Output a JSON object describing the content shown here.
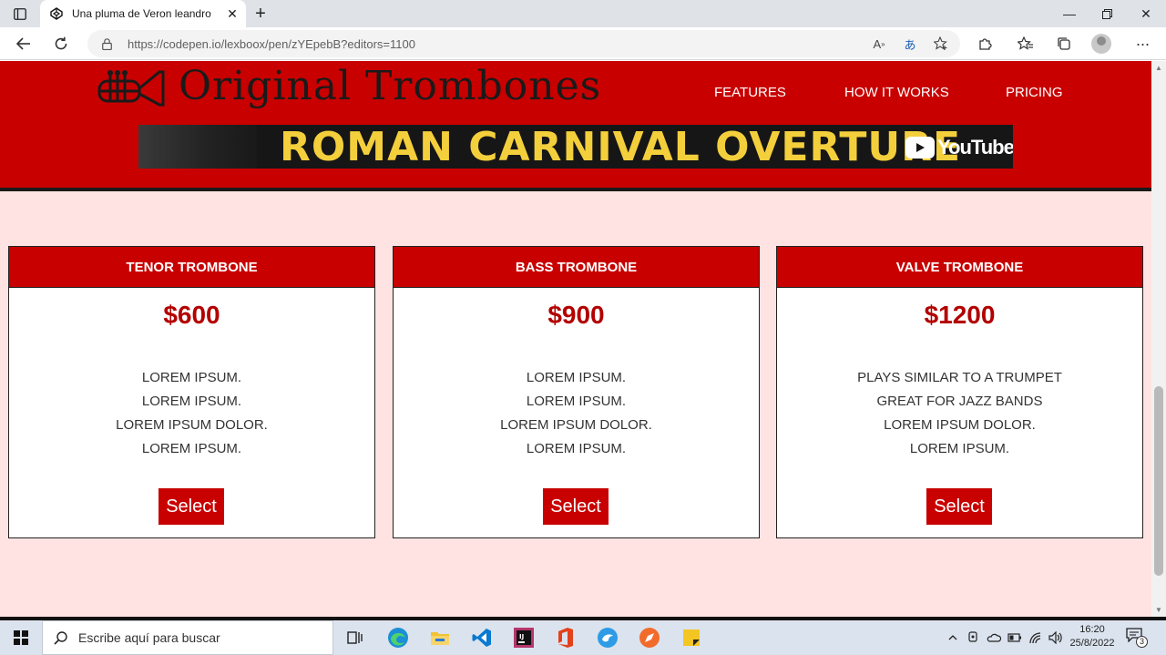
{
  "browser": {
    "tab_title": "Una pluma de Veron leandro",
    "url": "https://codepen.io/lexboox/pen/zYEpebB?editors=1100",
    "icons": [
      "sidebar-icon",
      "codepen-icon",
      "close-icon",
      "plus-icon",
      "minimize-icon",
      "restore-icon",
      "close-window-icon",
      "back-icon",
      "refresh-icon",
      "lock-icon",
      "read-aloud-icon",
      "translate-icon",
      "favorite-add-icon",
      "extensions-icon",
      "favorites-icon",
      "collections-icon",
      "avatar",
      "more-icon"
    ]
  },
  "site": {
    "brand": "Original Trombones",
    "nav": [
      "FEATURES",
      "HOW IT WORKS",
      "PRICING"
    ],
    "video": {
      "title": "ROMAN CARNIVAL OVERTURE",
      "platform": "YouTube"
    },
    "colors": {
      "header": "#c80000",
      "background": "#ffe3e3",
      "price": "#b30000",
      "video_title": "#f4cf3c"
    }
  },
  "cards": [
    {
      "title": "TENOR TROMBONE",
      "price": "$600",
      "features": [
        "LOREM IPSUM.",
        "LOREM IPSUM.",
        "LOREM IPSUM DOLOR.",
        "LOREM IPSUM."
      ],
      "button": "Select"
    },
    {
      "title": "BASS TROMBONE",
      "price": "$900",
      "features": [
        "LOREM IPSUM.",
        "LOREM IPSUM.",
        "LOREM IPSUM DOLOR.",
        "LOREM IPSUM."
      ],
      "button": "Select"
    },
    {
      "title": "VALVE TROMBONE",
      "price": "$1200",
      "features": [
        "PLAYS SIMILAR TO A TRUMPET",
        "GREAT FOR JAZZ BANDS",
        "LOREM IPSUM DOLOR.",
        "LOREM IPSUM."
      ],
      "button": "Select"
    }
  ],
  "taskbar": {
    "search_placeholder": "Escribe aquí para buscar",
    "time": "16:20",
    "date": "25/8/2022",
    "notification_count": "3",
    "apps": [
      "task-view-icon",
      "edge-icon",
      "file-explorer-icon",
      "vscode-icon",
      "jetbrains-icon",
      "office-icon",
      "app-bird-icon",
      "app-compass-icon",
      "sticky-notes-icon"
    ]
  }
}
